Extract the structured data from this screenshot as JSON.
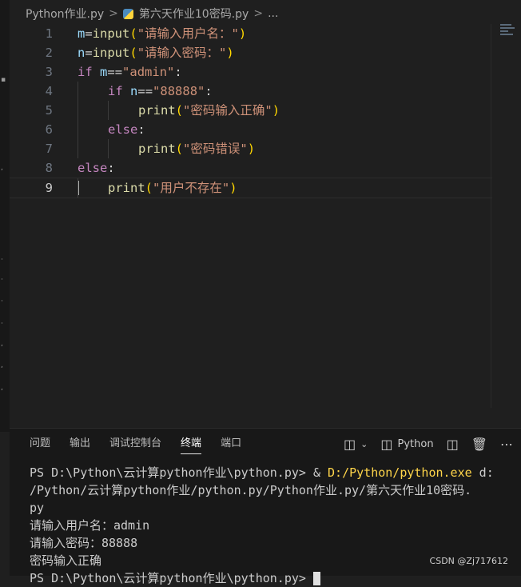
{
  "breadcrumb": {
    "file": "Python作业.py",
    "sep": ">",
    "current_file": "第六天作业10密码.py",
    "more": "..."
  },
  "editor": {
    "active_line": 9,
    "lines": [
      {
        "n": "1",
        "indent": 0,
        "tokens": [
          [
            "var",
            "m"
          ],
          [
            "op",
            "="
          ],
          [
            "fn",
            "input"
          ],
          [
            "br1",
            "("
          ],
          [
            "str",
            "\"请输入用户名：\""
          ],
          [
            "br1",
            ")"
          ]
        ]
      },
      {
        "n": "2",
        "indent": 0,
        "tokens": [
          [
            "var",
            "n"
          ],
          [
            "op",
            "="
          ],
          [
            "fn",
            "input"
          ],
          [
            "br1",
            "("
          ],
          [
            "str",
            "\"请输入密码：\""
          ],
          [
            "br1",
            ")"
          ]
        ]
      },
      {
        "n": "3",
        "indent": 0,
        "tokens": [
          [
            "kw",
            "if"
          ],
          [
            "op",
            " "
          ],
          [
            "var",
            "m"
          ],
          [
            "op",
            "=="
          ],
          [
            "str",
            "\"admin\""
          ],
          [
            "op",
            ":"
          ]
        ]
      },
      {
        "n": "4",
        "indent": 1,
        "tokens": [
          [
            "kw",
            "if"
          ],
          [
            "op",
            " "
          ],
          [
            "var",
            "n"
          ],
          [
            "op",
            "=="
          ],
          [
            "str",
            "\"88888\""
          ],
          [
            "op",
            ":"
          ]
        ]
      },
      {
        "n": "5",
        "indent": 2,
        "tokens": [
          [
            "fn",
            "print"
          ],
          [
            "br1",
            "("
          ],
          [
            "str",
            "\"密码输入正确\""
          ],
          [
            "br1",
            ")"
          ]
        ]
      },
      {
        "n": "6",
        "indent": 1,
        "tokens": [
          [
            "kw",
            "else"
          ],
          [
            "op",
            ":"
          ]
        ]
      },
      {
        "n": "7",
        "indent": 2,
        "tokens": [
          [
            "fn",
            "print"
          ],
          [
            "br1",
            "("
          ],
          [
            "str",
            "\"密码错误\""
          ],
          [
            "br1",
            ")"
          ]
        ]
      },
      {
        "n": "8",
        "indent": 0,
        "tokens": [
          [
            "kw",
            "else"
          ],
          [
            "op",
            ":"
          ]
        ]
      },
      {
        "n": "9",
        "indent": 1,
        "tokens": [
          [
            "fn",
            "print"
          ],
          [
            "br1",
            "("
          ],
          [
            "str",
            "\"用户不存在\""
          ],
          [
            "br1",
            ")"
          ]
        ]
      }
    ]
  },
  "panel": {
    "tabs": [
      {
        "label": "问题",
        "active": false
      },
      {
        "label": "输出",
        "active": false
      },
      {
        "label": "调试控制台",
        "active": false
      },
      {
        "label": "终端",
        "active": true
      },
      {
        "label": "端口",
        "active": false
      }
    ],
    "shell_label": "Python"
  },
  "terminal": {
    "lines": [
      {
        "text": "PS D:\\Python\\云计算python作业\\python.py> & ",
        "cmd": "D:/Python/python.exe",
        "rest": " d:"
      },
      {
        "text": "/Python/云计算python作业/python.py/Python作业.py/第六天作业10密码."
      },
      {
        "text": "py"
      },
      {
        "text": "请输入用户名：admin"
      },
      {
        "text": "请输入密码：88888"
      },
      {
        "text": "密码输入正确"
      },
      {
        "text": "PS D:\\Python\\云计算python作业\\python.py> "
      }
    ]
  },
  "watermark": "CSDN @Zj717612",
  "icons": {
    "split_layout": "split-layout-icon",
    "chevron": "chevron-down-icon",
    "python_terminal": "terminal-icon",
    "split_terminal": "split-terminal-icon",
    "trash": "trash-icon",
    "more": "ellipsis-icon"
  }
}
